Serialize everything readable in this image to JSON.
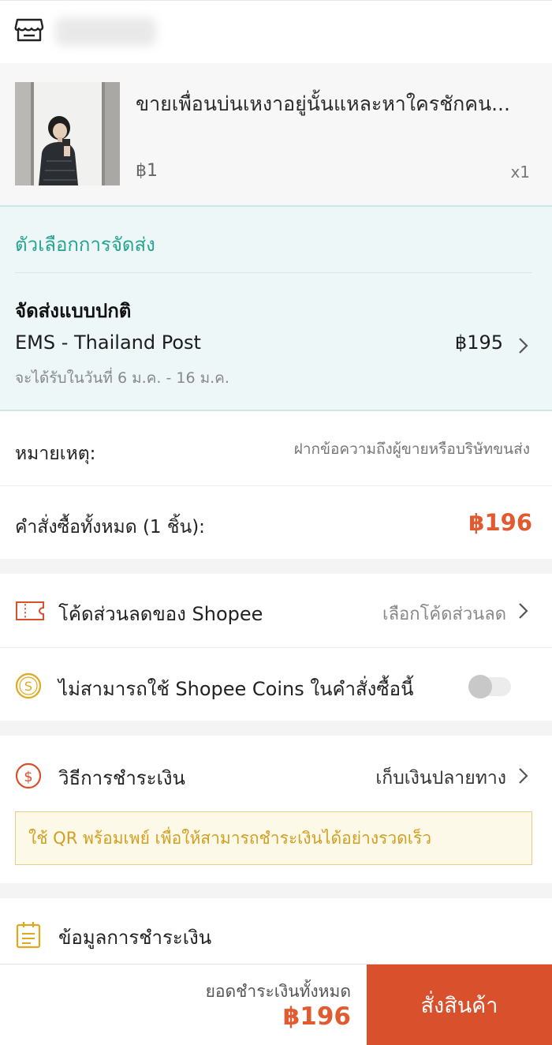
{
  "shop": {
    "icon": "shop-icon",
    "name_blurred": true
  },
  "product": {
    "title": "ขายเพื่อนบ่นเหงาอยู่นั้นแหละหาใครชักคน...",
    "price": "฿1",
    "quantity": "x1",
    "image": "person-photo"
  },
  "shipping": {
    "heading": "ตัวเลือกการจัดส่ง",
    "type": "จัดส่งแบบปกติ",
    "carrier": "EMS - Thailand Post",
    "price": "฿195",
    "eta": "จะได้รับในวันที่ 6 ม.ค. - 16 ม.ค.",
    "chevron": "›"
  },
  "note": {
    "label": "หมายเหตุ:",
    "placeholder": "ฝากข้อความถึงผู้ขายหรือบริษัทขนส่ง",
    "value": ""
  },
  "order_total": {
    "label": "คำสั่งซื้อทั้งหมด (1 ชิ้น):",
    "value": "฿196"
  },
  "voucher": {
    "icon": "voucher-ticket-icon",
    "label": "โค้ดส่วนลดของ Shopee",
    "select": "เลือกโค้ดส่วนลด",
    "chevron": "›"
  },
  "coins": {
    "icon": "coin-icon",
    "label": "ไม่สามารถใช้ Shopee Coins ในคำสั่งซื้อนี้",
    "enabled": false
  },
  "payment": {
    "icon": "dollar-circle-icon",
    "label": "วิธีการชำระเงิน",
    "value": "เก็บเงินปลายทาง",
    "chevron": "›",
    "promo": "ใช้ QR พร้อมเพย์ เพื่อให้สามารถชำระเงินได้อย่างรวดเร็ว"
  },
  "payment_info": {
    "icon": "clipboard-icon",
    "label": "ข้อมูลการชำระเงิน"
  },
  "footer": {
    "total_label": "ยอดชำระเงินทั้งหมด",
    "total_value": "฿196",
    "order_button": "สั่งสินค้า"
  },
  "colors": {
    "accent": "#e25a2f",
    "button": "#d9502d",
    "shipping_bg": "#eef7f8",
    "teal": "#27a391",
    "promo_text": "#d19f22"
  }
}
